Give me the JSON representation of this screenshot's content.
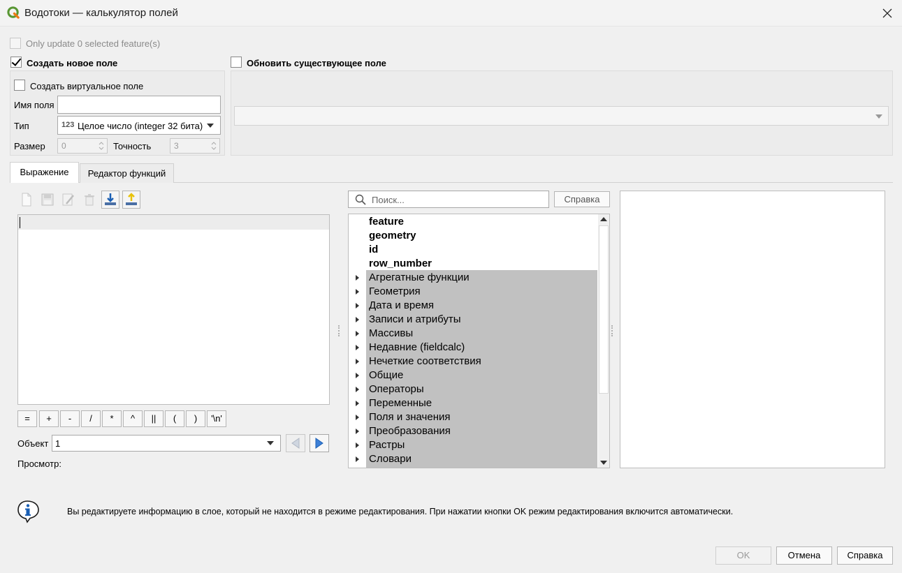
{
  "window": {
    "title": "Водотоки — калькулятор полей"
  },
  "options": {
    "only_update_label": "Only update 0 selected feature(s)",
    "create_new_label": "Создать новое поле",
    "update_existing_label": "Обновить существующее поле",
    "create_virtual_label": "Создать виртуальное поле",
    "field_name_label": "Имя поля",
    "field_name_value": "",
    "type_label": "Тип",
    "type_icon": "123",
    "type_value": "Целое число (integer 32 бита)",
    "size_label": "Размер",
    "size_value": "0",
    "precision_label": "Точность",
    "precision_value": "3",
    "existing_field_value": ""
  },
  "tabs": [
    "Выражение",
    "Редактор функций"
  ],
  "editor": {
    "toolbar_icons": [
      "new-file-icon",
      "save-icon",
      "edit-icon",
      "delete-icon",
      "import-icon",
      "export-icon"
    ],
    "expression": "",
    "operators": [
      "=",
      "+",
      "-",
      "/",
      "*",
      "^",
      "||",
      "(",
      ")",
      "'\\n'"
    ],
    "feature_label": "Объект",
    "feature_value": "1",
    "preview_label": "Просмотр:"
  },
  "functions": {
    "search_placeholder": "Поиск...",
    "help_label": "Справка",
    "items": [
      {
        "label": "feature",
        "bold": true,
        "group": false
      },
      {
        "label": "geometry",
        "bold": true,
        "group": false
      },
      {
        "label": "id",
        "bold": true,
        "group": false
      },
      {
        "label": "row_number",
        "bold": true,
        "group": false
      },
      {
        "label": "Агрегатные функции",
        "bold": false,
        "group": true
      },
      {
        "label": "Геометрия",
        "bold": false,
        "group": true
      },
      {
        "label": "Дата и время",
        "bold": false,
        "group": true
      },
      {
        "label": "Записи и атрибуты",
        "bold": false,
        "group": true
      },
      {
        "label": "Массивы",
        "bold": false,
        "group": true
      },
      {
        "label": "Недавние (fieldcalc)",
        "bold": false,
        "group": true
      },
      {
        "label": "Нечеткие соответствия",
        "bold": false,
        "group": true
      },
      {
        "label": "Общие",
        "bold": false,
        "group": true
      },
      {
        "label": "Операторы",
        "bold": false,
        "group": true
      },
      {
        "label": "Переменные",
        "bold": false,
        "group": true
      },
      {
        "label": "Поля и значения",
        "bold": false,
        "group": true
      },
      {
        "label": "Преобразования",
        "bold": false,
        "group": true
      },
      {
        "label": "Растры",
        "bold": false,
        "group": true
      },
      {
        "label": "Словари",
        "bold": false,
        "group": true
      }
    ]
  },
  "message": {
    "text": "Вы редактируете информацию в слое, который не находится в режиме редактирования. При нажатии кнопки OK режим редактирования включится автоматически."
  },
  "buttons": {
    "ok": "OK",
    "cancel": "Отмена",
    "help": "Справка"
  },
  "colors": {
    "brand": "#589632",
    "info": "#1a5fb4",
    "group_bg": "#c1c1c1"
  }
}
